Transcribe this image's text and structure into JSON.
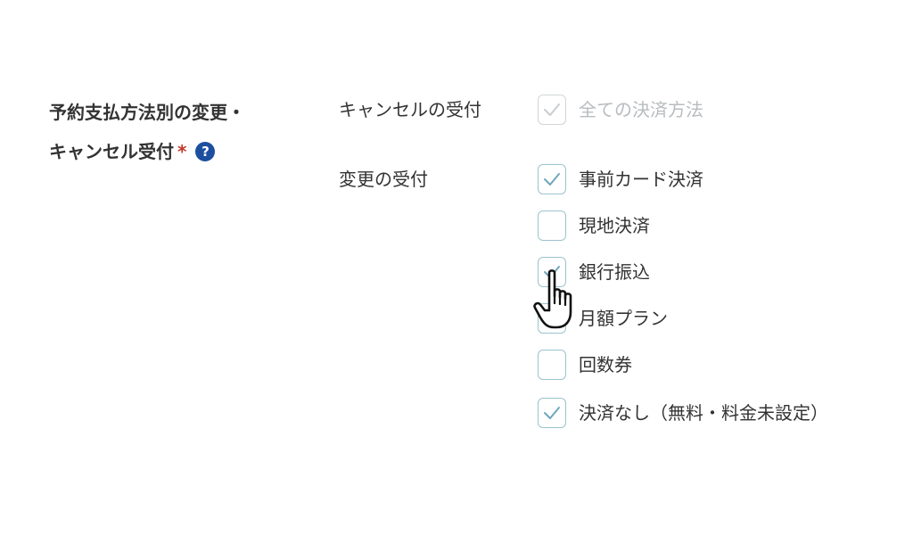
{
  "field": {
    "label_line1": "予約支払方法別の変更・",
    "label_line2": "キャンセル受付",
    "required_mark": "*",
    "help_icon_glyph": "?"
  },
  "cancel": {
    "label": "キャンセルの受付",
    "options": [
      {
        "label": "全ての決済方法",
        "checked": true,
        "disabled": true
      }
    ]
  },
  "change": {
    "label": "変更の受付",
    "options": [
      {
        "label": "事前カード決済",
        "checked": true
      },
      {
        "label": "現地決済",
        "checked": false
      },
      {
        "label": "銀行振込",
        "checked": true
      },
      {
        "label": "月額プラン",
        "checked": false
      },
      {
        "label": "回数券",
        "checked": false
      },
      {
        "label": "決済なし（無料・料金未設定）",
        "checked": true
      }
    ]
  },
  "colors": {
    "checkbox_border": "#9cc3cf",
    "check_mark": "#6fa7bb",
    "disabled_border": "#d2d6d8",
    "disabled_text": "#b8bcbf",
    "required": "#c0392b",
    "help_icon_bg": "#1d4fa0"
  },
  "icons": {
    "help": "help-icon",
    "check": "check-icon",
    "pointer": "hand-pointer-cursor-icon"
  }
}
